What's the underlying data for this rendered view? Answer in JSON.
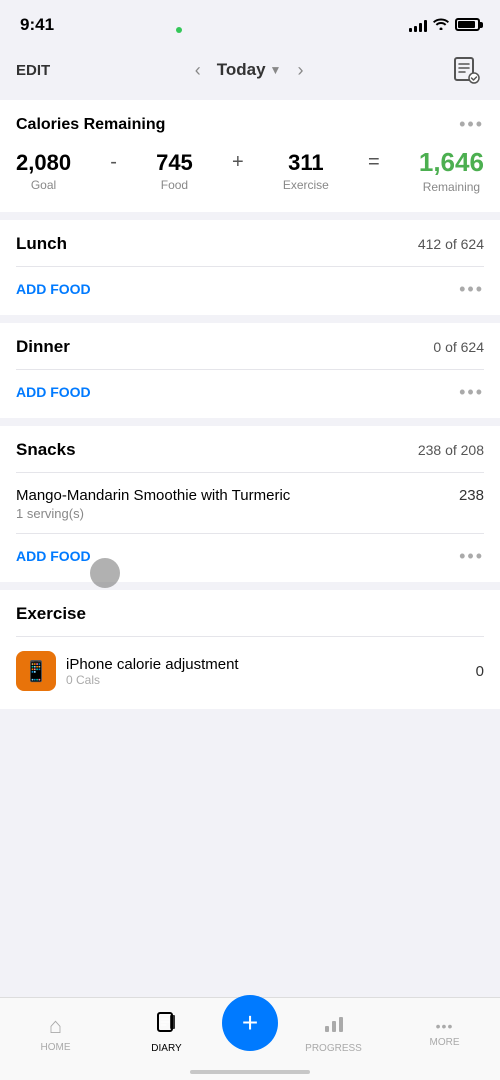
{
  "statusBar": {
    "time": "9:41",
    "batteryAlt": "battery"
  },
  "header": {
    "editLabel": "EDIT",
    "todayLabel": "Today",
    "prevArrow": "‹",
    "nextArrow": "›"
  },
  "caloriesCard": {
    "title": "Calories Remaining",
    "goal": {
      "value": "2,080",
      "label": "Goal"
    },
    "food": {
      "value": "745",
      "label": "Food"
    },
    "exercise": {
      "value": "311",
      "label": "Exercise"
    },
    "remaining": {
      "value": "1,646",
      "label": "Remaining"
    },
    "minus": "-",
    "plus": "+",
    "equals": "=",
    "dotsLabel": "•••"
  },
  "meals": [
    {
      "name": "Lunch",
      "calories": "412 of 624",
      "addFoodLabel": "ADD FOOD",
      "dotsLabel": "•••",
      "items": []
    },
    {
      "name": "Dinner",
      "calories": "0 of 624",
      "addFoodLabel": "ADD FOOD",
      "dotsLabel": "•••",
      "items": []
    },
    {
      "name": "Snacks",
      "calories": "238 of 208",
      "addFoodLabel": "ADD FOOD",
      "dotsLabel": "•••",
      "items": [
        {
          "name": "Mango-Mandarin Smoothie with Turmeric",
          "serving": "1 serving(s)",
          "calories": "238"
        }
      ]
    }
  ],
  "exercise": {
    "title": "Exercise",
    "item": {
      "name": "iPhone calorie adjustment",
      "calories": "0"
    }
  },
  "tabBar": {
    "tabs": [
      {
        "label": "HOME",
        "icon": "⌂",
        "active": false
      },
      {
        "label": "DIARY",
        "icon": "📓",
        "active": true
      },
      {
        "label": "",
        "icon": "+",
        "active": false,
        "isAdd": true
      },
      {
        "label": "PROGRESS",
        "icon": "📊",
        "active": false
      },
      {
        "label": "MORE",
        "icon": "•••",
        "active": false
      }
    ]
  }
}
